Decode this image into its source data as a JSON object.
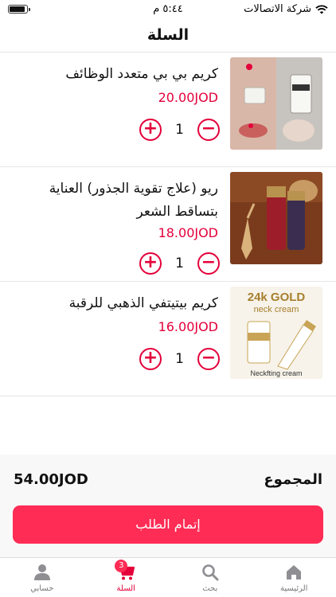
{
  "status_bar": {
    "carrier": "شركة الاتصالات",
    "time": "٥:٤٤ م",
    "battery_level": 0.9
  },
  "header": {
    "title": "السلة"
  },
  "cart": {
    "items": [
      {
        "name": "كريم  بي بي متعدد الوظائف",
        "price": "20.00JOD",
        "quantity": "1"
      },
      {
        "name": "ريو (علاج تقوية الجذور) العناية بتساقط الشعر",
        "price": "18.00JOD",
        "quantity": "1"
      },
      {
        "name": "كريم بيتيتفي الذهبي للرقبة",
        "price": "16.00JOD",
        "quantity": "1"
      }
    ],
    "product_image_text": {
      "item3_heading": "24k GOLD",
      "item3_sub": "neck cream",
      "item3_caption": "Neckfting cream"
    },
    "plus_symbol": "+",
    "minus_symbol": "−"
  },
  "total": {
    "label": "المجموع",
    "amount": "54.00JOD"
  },
  "checkout": {
    "label": "إتمام الطلب"
  },
  "tabbar": {
    "badge_count": "3",
    "items": [
      {
        "label": "الرئيسية",
        "icon": "home-icon"
      },
      {
        "label": "بحث",
        "icon": "search-icon"
      },
      {
        "label": "السلة",
        "icon": "cart-icon"
      },
      {
        "label": "حسابي",
        "icon": "user-icon"
      }
    ]
  },
  "colors": {
    "accent": "#e4003a",
    "button": "#ff2c55",
    "inactive_icon": "#8e8e93"
  }
}
